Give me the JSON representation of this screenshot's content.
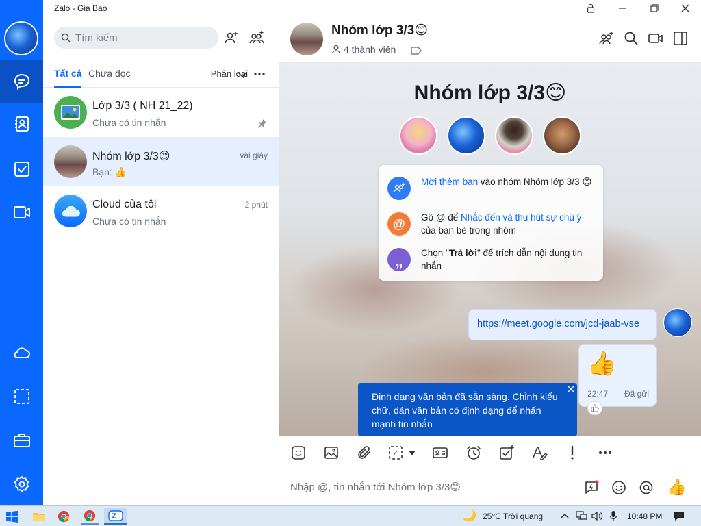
{
  "window": {
    "title": "Zalo - Gia Bao"
  },
  "colors": {
    "brand": "#0a68fe",
    "nav_active": "#0951c5",
    "selected_row": "#e5efff",
    "tooltip": "#0a56c7"
  },
  "sidebar": {
    "items": [
      {
        "icon": "chat-icon",
        "active": true
      },
      {
        "icon": "contacts-icon",
        "active": false
      },
      {
        "icon": "todo-icon",
        "active": false
      },
      {
        "icon": "video-call-icon",
        "active": false
      },
      {
        "icon": "cloud-icon",
        "active": false
      },
      {
        "icon": "screenshot-icon",
        "active": false
      },
      {
        "icon": "toolbox-icon",
        "active": false
      },
      {
        "icon": "settings-icon",
        "active": false
      }
    ]
  },
  "list": {
    "search_placeholder": "Tìm kiếm",
    "tabs": {
      "all": "Tất cả",
      "unread": "Chưa đọc",
      "classify": "Phân loại"
    },
    "conversations": [
      {
        "name": "Lớp 3/3 ( NH 21_22)",
        "preview": "Chưa có tin nhắn",
        "time": "",
        "pinned": true
      },
      {
        "name": "Nhóm lớp 3/3😊",
        "preview": "Bạn: 👍",
        "time": "vài giây",
        "active": true
      },
      {
        "name": "Cloud của tôi",
        "preview": "Chưa có tin nhắn",
        "time": "2 phút"
      }
    ]
  },
  "chat": {
    "group_name": "Nhóm lớp 3/3😊",
    "members_label": "4 thành viên",
    "welcome_title": "Nhóm lớp 3/3😊",
    "hints": [
      {
        "link": "Mời thêm bạn",
        "rest": " vào nhóm Nhóm lớp 3/3 😊"
      },
      {
        "pre": "Gõ @ để ",
        "link": "Nhắc đến và thu hút sự chú ý",
        "rest": " của bạn bè trong nhóm"
      },
      {
        "pre": "Chọn \"",
        "bold": "Trả lời",
        "rest": "\" để trích dẫn nội dung tin nhắn"
      }
    ],
    "messages": [
      {
        "text": "https://meet.google.com/jcd-jaab-vse"
      },
      {
        "emoji": "👍",
        "time": "22:47",
        "status": "Đã gửi"
      }
    ],
    "tooltip": "Định dạng văn bản đã sẵn sàng. Chỉnh kiểu chữ, dán văn bản có định dạng để nhấn mạnh tin nhắn",
    "composer_placeholder": "Nhập @, tin nhắn tới Nhóm lớp 3/3😊",
    "quick_like": "👍"
  },
  "taskbar": {
    "weather": "25°C  Trời quang",
    "clock": "10:48 PM"
  }
}
